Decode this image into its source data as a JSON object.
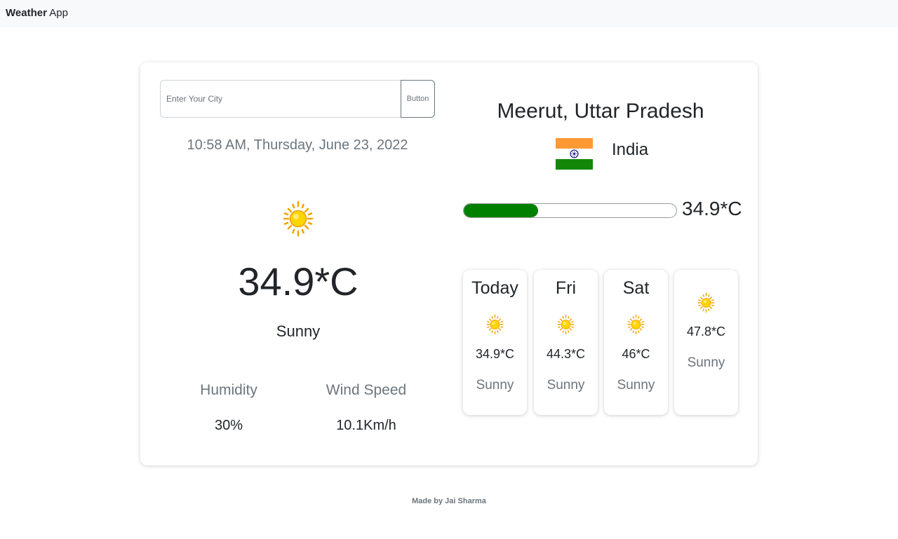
{
  "navbar": {
    "brand_bold": "Weather",
    "brand_light": "App"
  },
  "search": {
    "placeholder": "Enter Your City",
    "button_label": "Button"
  },
  "current": {
    "datetime": "10:58 AM, Thursday, June 23, 2022",
    "icon": "sun-icon",
    "temperature": "34.9*C",
    "condition": "Sunny",
    "humidity_label": "Humidity",
    "humidity_value": "30%",
    "wind_label": "Wind Speed",
    "wind_value": "10.1Km/h"
  },
  "location": {
    "city": "Meerut, Uttar Pradesh",
    "country": "India",
    "flag_icon": "india-flag-icon"
  },
  "temperature_bar": {
    "fill_fraction": 0.35,
    "label": "34.9*C",
    "fill_color": "#008000"
  },
  "forecast": [
    {
      "day": "Today",
      "icon": "sun-icon",
      "temp": "34.9*C",
      "condition": "Sunny"
    },
    {
      "day": "Fri",
      "icon": "sun-icon",
      "temp": "44.3*C",
      "condition": "Sunny"
    },
    {
      "day": "Sat",
      "icon": "sun-icon",
      "temp": "46*C",
      "condition": "Sunny"
    },
    {
      "day": "",
      "icon": "sun-icon",
      "temp": "47.8*C",
      "condition": "Sunny"
    }
  ],
  "footer": {
    "text": "Made by Jai Sharma"
  },
  "colors": {
    "sun_yellow": "#ffd700",
    "sun_ray": "#f5a300",
    "saffron": "#ff9933",
    "green": "#138808",
    "chakra": "#000080"
  }
}
